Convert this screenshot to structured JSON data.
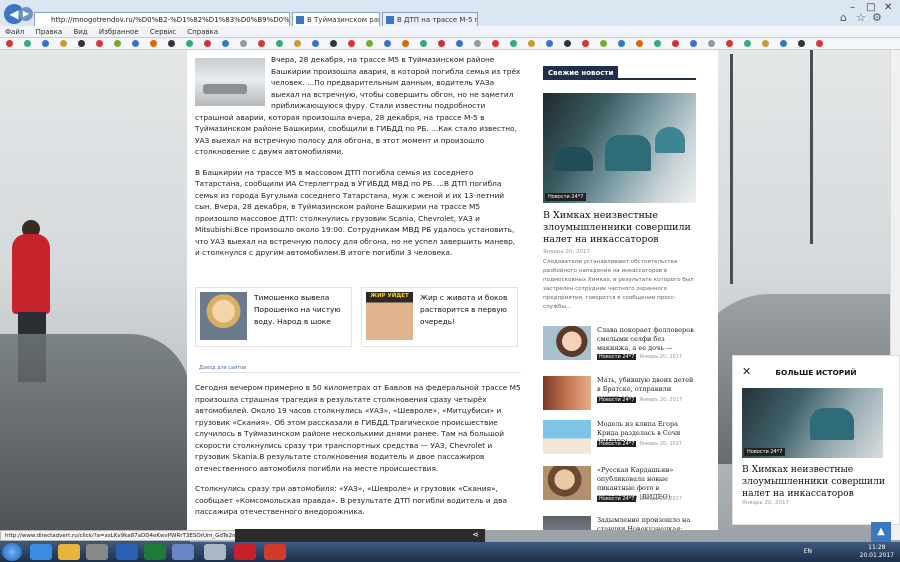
{
  "browser": {
    "address": "http://mnogotrendov.ru/%D0%B2-%D1%82%D1%83%D0%B9%D0%BC%D0%B0%D0%B7...",
    "tabs": [
      {
        "label": "В Туймазинском районе п...",
        "active": true
      },
      {
        "label": "В ДТП на трассе М-5 погиб о...",
        "active": false
      }
    ],
    "menu": [
      "Файл",
      "Правка",
      "Вид",
      "Избранное",
      "Сервис",
      "Справка"
    ]
  },
  "article": {
    "para1": "Вчера, 28 декабря, на трассе М5 в Туймазинском районе Башкирии произошла авария, в которой погибла семья из трёх человек. ...По предварительным данным, водитель УАЗа выехал на встречную, чтобы совершить обгон, но не заметил приближающуюся фуру. Стали известны подробности страшной аварии, которая произошла вчера, 28 декабря, на трассе М-5 в Туймазинском районе Башкирии, сообщили в ГИБДД по РБ. ...Как стало известно, УАЗ выехал на встречную полосу для обгона, в этот момент и произошло столкновение с двумя автомобилями.",
    "para2": "В Башкирии на трассе М5 в массовом ДТП погибла семья из соседнего Татарстана, сообщили ИА Стерлегград в УГИБДД МВД по РБ. ...В ДТП погибла семья из города Бугульма соседнего Татарстана, муж с женой и их 13-летний сын. Вчера, 28 декабря, в Туймазинском районе Башкирии на трассе М5 произошло массовое ДТП: столкнулись грузовик Scania, Chevrolet, УАЗ и Mitsubishi.Все произошло около 19:00. Сотрудникам МВД РБ удалось установить, что УАЗ выехал на встречную полосу для обгона, но не успел завершить маневр, и столкнулся с другим автомобилем.В итоге погибли 3 человека.",
    "related": [
      {
        "title": "Тимошенко вывела Порошенко на чистую воду. Народ в шоке"
      },
      {
        "title": "Жир с живота и боков растворится в первую очередь!",
        "image_caption": "ЖИР УЙДЕТ"
      }
    ],
    "ads_label": "Довод для сайтов",
    "para3": "Сегодня вечером примерно в 50 километрах от Бавлов на федеральной трассе М5 произошла страшная трагедия в результате столкновения сразу четырёх автомобилей. Около 19 часов столкнулись «УАЗ», «Шевроле», «Митцубиси» и грузовик «Скания». Об этом рассказали в ГИБДД.Трагическое происшествие случилось в Туймазинском районе несколькими днями ранее. Там на большой скорости столкнулись сразу три транспортных средства — УАЗ, Chevrolet и грузовик Skania.В результате столкновения водитель и двое пассажиров отечественного автомобиля погибли на месте происшествия.",
    "para4": "Столкнулись сразу три автомобиля: «УАЗ», «Шевроле» и грузовик «Скания», сообщает «Комсомольская правда». В результате ДТП погибли водитель и два пассажира отечественного внедорожника."
  },
  "sidebar": {
    "heading": "Свежие новости",
    "hero": {
      "badge": "Новости 24*7",
      "title": "В Химках неизвестные злоумышленники совершили налет на инкассаторов",
      "date": "Январь 20, 2017",
      "excerpt": "Следователи устанавливают обстоятельства разбойного нападения на инкассаторов в подмосковных Химках, в результате которого был застрелен сотрудник частного охранного предприятия, говорится в сообщении пресс-службы..."
    },
    "items": [
      {
        "title": "Слава покорает фолловеров смелыми селфи без макияжа, а ее дочь —",
        "badge": "Новости 24*7",
        "date": "Январь 20, 2017"
      },
      {
        "title": "Мать, убившую двоих детей в Братске, отправили лечиться",
        "badge": "Новости 24*7",
        "date": "Январь 20, 2017"
      },
      {
        "title": "Модель из клипа Егора Крида разделась в Сочи (ВИДЕО)",
        "badge": "Новости 24*7",
        "date": "Январь 20, 2017"
      },
      {
        "title": "«Русская Кардашьян» опубликовала новые пикантные фото в купальнике (ВИДЕО)",
        "badge": "Новости 24*7",
        "date": "Январь 20, 2017"
      },
      {
        "title": "Задымление произошло на станции Новокузнецкая: видео (ВИДЕО)",
        "badge": "",
        "date": ""
      }
    ]
  },
  "more": {
    "heading": "БОЛЬШЕ ИСТОРИЙ",
    "badge": "Новости 24*7",
    "title": "В Химках неизвестные злоумышленники совершили налет на инкассаторов",
    "date": "Январь 20, 2017"
  },
  "status_url": "http://www.directadvert.ru/click/?a=xsLKv9ka87aDD4eKwvPWRrT3ESOrUm_GdTe2mhLVmwAvPRZsKCCAbMMPUYrec8-n0RK7dsvv5d7yb8Q7dlv7q-eoq1wiP1Rl2wh9YFuUsmx-g...",
  "taskbar": {
    "lang": "EN",
    "time": "11:28",
    "date": "20.01.2017"
  },
  "icons": {
    "close": "✕",
    "back": "◀",
    "forward": "▶",
    "up": "▲"
  }
}
